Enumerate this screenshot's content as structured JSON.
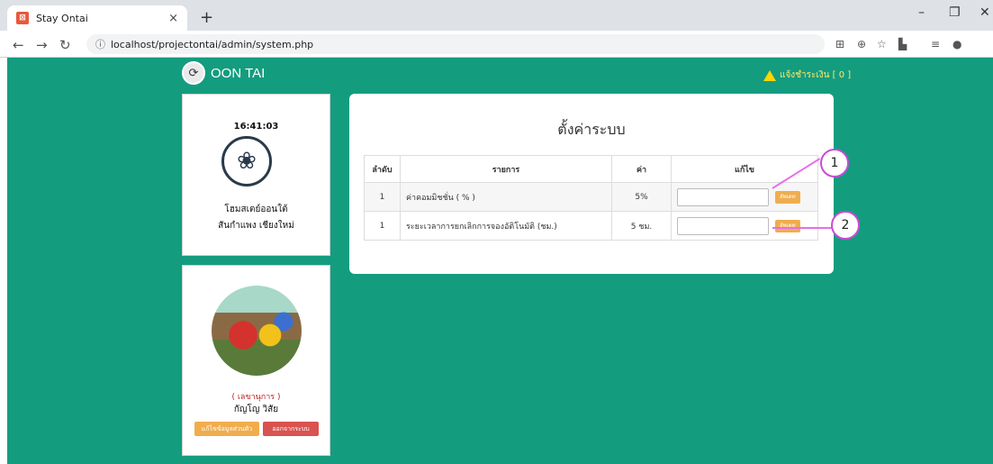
{
  "browser": {
    "tab_title": "Stay Ontai",
    "tab_icon": "xampp-icon",
    "url": "localhost/projectontai/admin/system.php",
    "close_glyph": "×",
    "new_tab_glyph": "+"
  },
  "header": {
    "brand": "OON TAI",
    "notice": "แจ้งชำระเงิน [ 0 ]"
  },
  "sidebar": {
    "time": "16:41:03",
    "home_name": "โฮมสเตย์ออนใต้",
    "home_place": "สันกำแพง เชียงใหม่",
    "role": "( เลขานุการ )",
    "user_name": "กัญโญ วิสัย",
    "edit_profile_label": "แก้ไขข้อมูลส่วนตัว",
    "logout_label": "ออกจากระบบ"
  },
  "main": {
    "title": "ตั้งค่าระบบ",
    "columns": [
      "ลำดับ",
      "รายการ",
      "ค่า",
      "แก้ไข"
    ],
    "rows": [
      {
        "no": "1",
        "item": "ค่าคอมมิชชั่น ( % )",
        "value": "5%",
        "button": "อัพเดท"
      },
      {
        "no": "1",
        "item": "ระยะเวลาการยกเลิกการจองอัติโนมัติ (ชม.)",
        "value": "5 ชม.",
        "button": "อัพเดท"
      }
    ]
  },
  "annotations": {
    "marker1": "1",
    "marker2": "2"
  },
  "colors": {
    "page_bg": "#149c7f",
    "update_button": "#f0ad4e",
    "logout_button": "#d9534f",
    "marker_border": "#c94bd6"
  }
}
